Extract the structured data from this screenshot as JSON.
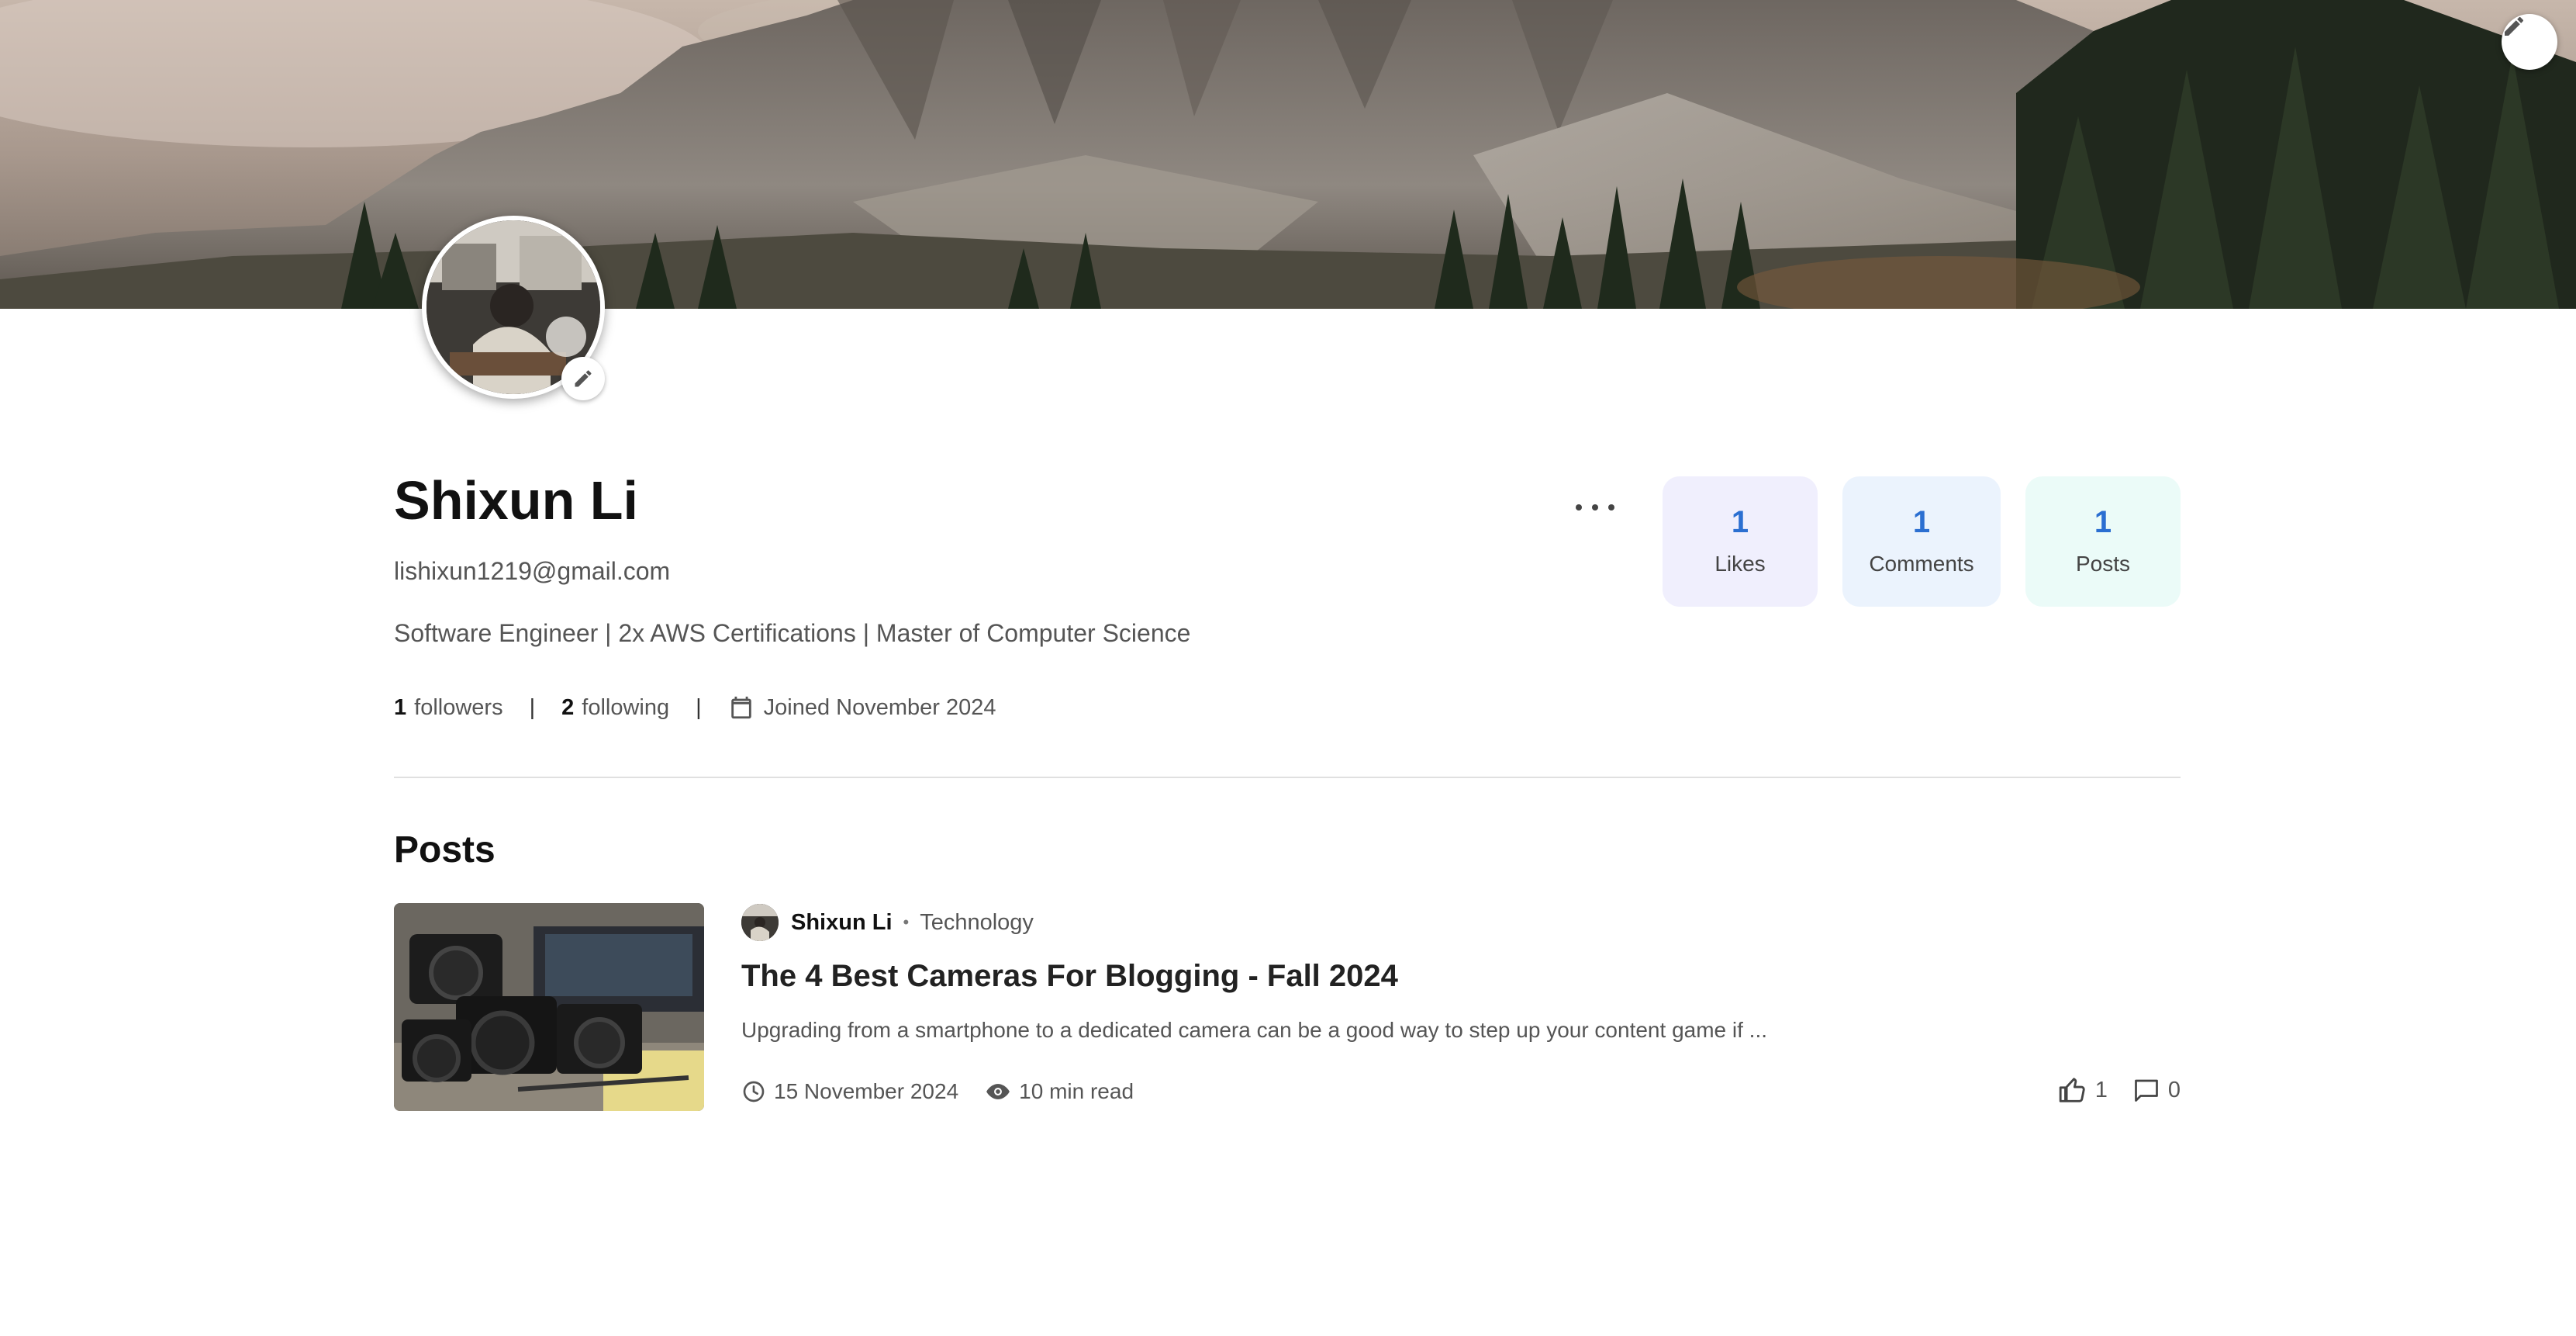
{
  "profile": {
    "name": "Shixun Li",
    "email": "lishixun1219@gmail.com",
    "bio": "Software Engineer | 2x AWS Certifications | Master of Computer Science",
    "followers_count": "1",
    "followers_label": "followers",
    "following_count": "2",
    "following_label": "following",
    "separator": "|",
    "joined": "Joined November 2024"
  },
  "stats": {
    "likes": {
      "value": "1",
      "label": "Likes"
    },
    "comments": {
      "value": "1",
      "label": "Comments"
    },
    "posts": {
      "value": "1",
      "label": "Posts"
    }
  },
  "posts_section": {
    "heading": "Posts",
    "items": [
      {
        "author": "Shixun Li",
        "dot": "•",
        "category": "Technology",
        "title": "The 4 Best Cameras For Blogging - Fall 2024",
        "excerpt": "Upgrading from a smartphone to a dedicated camera can be a good way to step up your content game if ...",
        "date": "15 November 2024",
        "read_time": "10 min read",
        "likes": "1",
        "comments": "0"
      }
    ]
  },
  "icons": {
    "banner_edit": "pencil-icon",
    "avatar_edit": "pencil-icon",
    "more": "more-horizontal-icon",
    "calendar": "calendar-icon",
    "clock": "clock-icon",
    "eye": "eye-icon",
    "like": "thumbs-up-icon",
    "comment": "comment-icon"
  },
  "colors": {
    "stat_value": "#2b6fd1",
    "likes_card_bg": "#f0effd",
    "comments_card_bg": "#ebf3fd",
    "posts_card_bg": "#ebfbf8"
  }
}
